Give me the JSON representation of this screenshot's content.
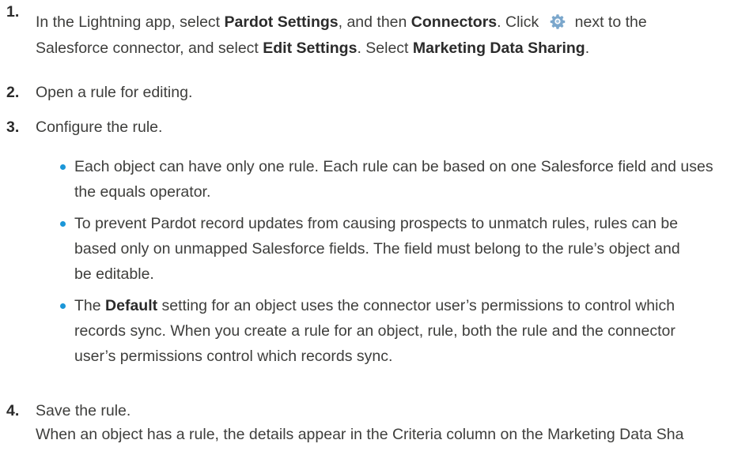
{
  "steps": [
    {
      "number": "1.",
      "line1": {
        "t1": "In the Lightning app, select ",
        "b1": "Pardot Settings",
        "t2": ", and then ",
        "b2": "Connectors",
        "t3": ". Click ",
        "icon": "gear-icon",
        "t4": "next to the"
      },
      "line2": {
        "t1": "Salesforce connector, and select ",
        "b1": "Edit Settings",
        "t2": ". Select ",
        "b2": "Marketing Data Sharing",
        "t3": "."
      }
    },
    {
      "number": "2.",
      "text": "Open a rule for editing."
    },
    {
      "number": "3.",
      "text": "Configure the rule.",
      "bullets": [
        {
          "lines": [
            "Each object can have only one rule. Each rule can be based on one Salesforce field and uses",
            "the equals operator."
          ]
        },
        {
          "lines": [
            "To prevent Pardot record updates from causing prospects to unmatch rules, rules can be",
            "based only on unmapped Salesforce fields. The field must belong to the rule’s object and",
            "be editable."
          ]
        },
        {
          "first": {
            "t1": "The ",
            "b1": "Default",
            "t2": " setting for an object uses the connector user’s permissions to control which"
          },
          "lines": [
            "records sync. When you create a rule for an object, rule, both the rule and the connector",
            "user’s permissions control which records sync."
          ]
        }
      ]
    },
    {
      "number": "4.",
      "text": "Save the rule.",
      "extra": "When an object has a rule, the details appear in the Criteria column on the Marketing Data Sha"
    }
  ],
  "colors": {
    "text": "#3e3e3c",
    "bullet": "#1b96d8",
    "gear": "#7ba7cc"
  }
}
